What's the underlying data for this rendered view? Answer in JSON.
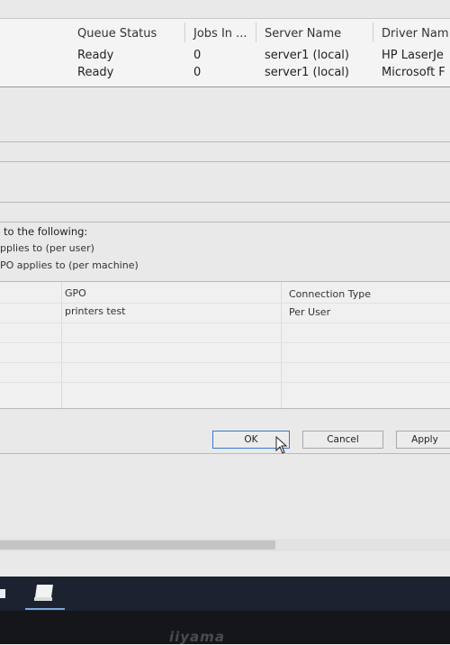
{
  "queue_table": {
    "columns": [
      "Queue Status",
      "Jobs In ...",
      "Server Name",
      "Driver Nam"
    ],
    "rows": [
      [
        "Ready",
        "0",
        "server1 (local)",
        "HP LaserJe"
      ],
      [
        "Ready",
        "0",
        "server1 (local)",
        "Microsoft F"
      ]
    ]
  },
  "deploy_panel": {
    "heading": "to the following:",
    "option_user": "pplies to (per user)",
    "option_machine": "PO applies to (per machine)"
  },
  "gpo_table": {
    "columns": [
      "GPO",
      "Connection Type"
    ],
    "rows": [
      [
        "printers test",
        "Per User"
      ]
    ]
  },
  "buttons": {
    "ok": "OK",
    "cancel": "Cancel",
    "apply": "Apply"
  },
  "monitor": {
    "brand": "iiyama"
  }
}
